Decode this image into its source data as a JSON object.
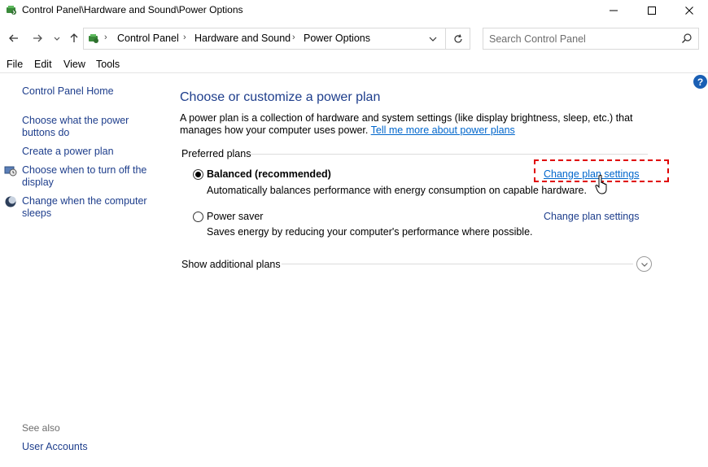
{
  "window": {
    "title": "Control Panel\\Hardware and Sound\\Power Options"
  },
  "address": {
    "crumbs": [
      "Control Panel",
      "Hardware and Sound",
      "Power Options"
    ]
  },
  "search": {
    "placeholder": "Search Control Panel"
  },
  "menu": {
    "file": "File",
    "edit": "Edit",
    "view": "View",
    "tools": "Tools"
  },
  "help": {
    "label": "?"
  },
  "left_pane": {
    "home": "Control Panel Home",
    "links": [
      "Choose what the power buttons do",
      "Create a power plan",
      "Choose when to turn off the display",
      "Change when the computer sleeps"
    ],
    "see_also": "See also",
    "accounts": "User Accounts"
  },
  "main": {
    "heading": "Choose or customize a power plan",
    "description": "A power plan is a collection of hardware and system settings (like display brightness, sleep, etc.) that manages how your computer uses power.",
    "description_link": "Tell me more about power plans",
    "preferred_label": "Preferred plans",
    "plans": [
      {
        "name": "Balanced (recommended)",
        "description": "Automatically balances performance with energy consumption on capable hardware.",
        "link": "Change plan settings",
        "selected": true
      },
      {
        "name": "Power saver",
        "description": "Saves energy by reducing your computer's performance where possible.",
        "link": "Change plan settings",
        "selected": false
      }
    ],
    "additional_label": "Show additional plans"
  },
  "colors": {
    "link_blue": "#0066cc",
    "nav_blue": "#1e3e8c",
    "highlight_red": "#e00000"
  },
  "icons": {
    "title": "power-options-icon",
    "back": "arrow-left-icon",
    "forward": "arrow-right-icon",
    "recent": "chevron-down-icon",
    "up": "arrow-up-icon",
    "refresh": "refresh-icon",
    "search": "search-icon",
    "help": "help-icon",
    "display": "display-clock-icon",
    "sleep": "moon-sleep-icon",
    "cursor": "hand-pointer-icon",
    "expand": "chevron-down-circle-icon"
  }
}
